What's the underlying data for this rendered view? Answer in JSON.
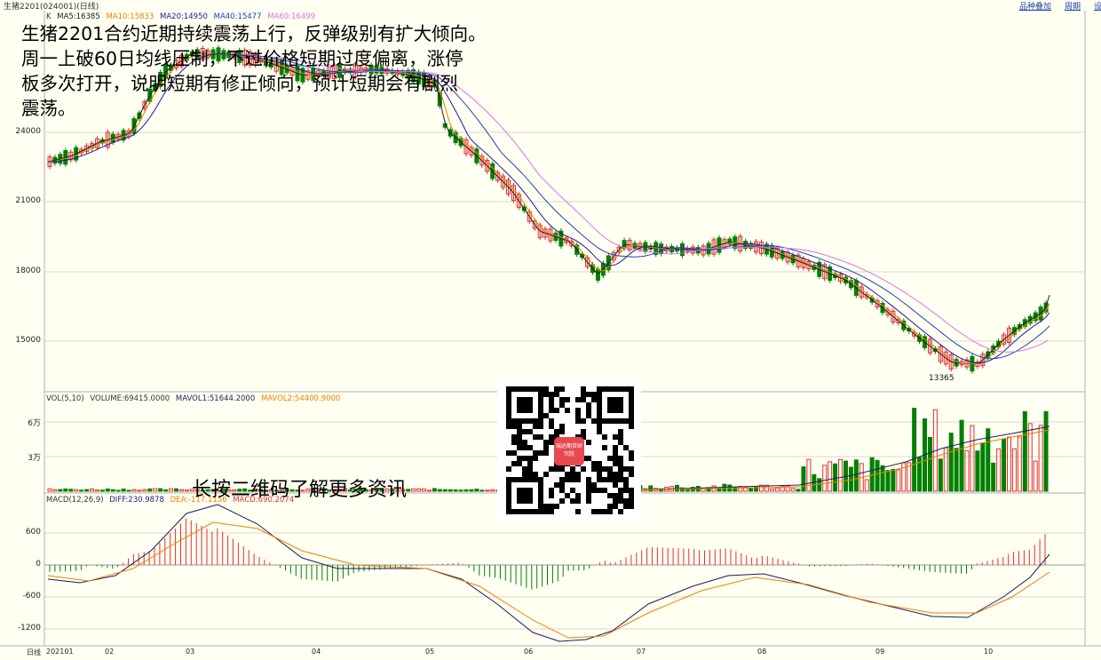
{
  "window": {
    "title": "生猪2201(024001)(日线)",
    "links": [
      "品种叠加",
      "周期",
      "设"
    ]
  },
  "price_panel": {
    "legend_prefix": "K",
    "ma": [
      {
        "label": "MA5:16385",
        "color": "#202020"
      },
      {
        "label": "MA10:15833",
        "color": "#f08000"
      },
      {
        "label": "MA20:14950",
        "color": "#1a1aa0"
      },
      {
        "label": "MA40:15477",
        "color": "#2040c0"
      },
      {
        "label": "MA60:16499",
        "color": "#e070e0"
      }
    ],
    "yticks": [
      "24000",
      "21000",
      "18000",
      "15000"
    ],
    "low_label": "13365"
  },
  "volume_panel": {
    "legend": [
      {
        "label": "VOL(5,10)",
        "color": "#333333"
      },
      {
        "label": "VOLUME:69415.0000",
        "color": "#333333"
      },
      {
        "label": "MAVOL1:51644.2000",
        "color": "#202060"
      },
      {
        "label": "MAVOL2:54400.9000",
        "color": "#f08000"
      }
    ],
    "yticks": [
      "6万",
      "3万"
    ]
  },
  "macd_panel": {
    "legend": [
      {
        "label": "MACD(12,26,9)",
        "color": "#333333"
      },
      {
        "label": "DIFF:230.9878",
        "color": "#1a1a80"
      },
      {
        "label": "DEA:-117.1156",
        "color": "#f08000"
      },
      {
        "label": "MACD:690.2074",
        "color": "#e03030"
      }
    ],
    "yticks": [
      "600",
      "0",
      "-600",
      "-1200"
    ]
  },
  "x_axis": {
    "period_label": "日线",
    "dates": [
      "202101",
      "02",
      "03",
      "04",
      "05",
      "06",
      "07",
      "08",
      "09",
      "10"
    ]
  },
  "annotation": {
    "lines": [
      "生猪2201合约近期持续震荡上行，反弹级别有扩大倾向。",
      "周一上破60日均线压制，不过价格短期过度偏离，涨停",
      "板多次打开，说明短期有修正倾向，预计短期会有剧烈",
      "震荡。"
    ]
  },
  "promo": {
    "text": "长按二维码了解更多资讯",
    "qr_logo_text": "瑞达期货研究院"
  },
  "colors": {
    "background": "#fffff2",
    "up_candle": "#e03030",
    "down_candle": "#008000",
    "link": "#1a3fb0"
  }
}
